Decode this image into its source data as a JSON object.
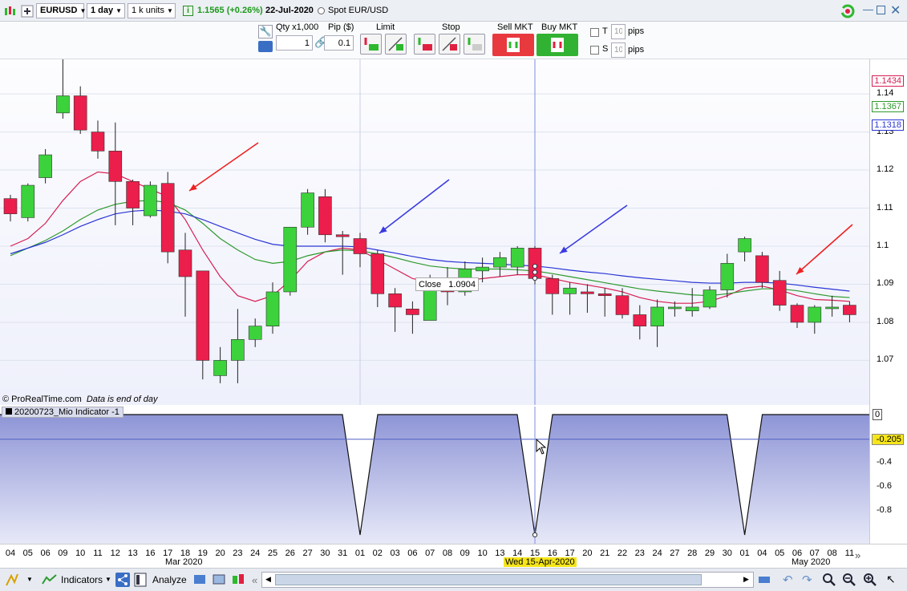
{
  "topbar": {
    "symbol": "EURUSD",
    "timeframe": "1 day",
    "units": "1 k units",
    "price": "1.1565 (+0.26%)",
    "date": "22-Jul-2020",
    "instrument": "Spot EUR/USD"
  },
  "order": {
    "qty_label": "Qty x1,000",
    "qty_value": "1",
    "pip_label": "Pip ($)",
    "pip_value": "0.1",
    "limit_label": "Limit",
    "stop_label": "Stop",
    "sell_label": "Sell MKT",
    "buy_label": "Buy MKT",
    "t_label": "T",
    "t_value": "10",
    "s_label": "S",
    "s_value": "10",
    "pips_label": "pips"
  },
  "chart": {
    "watermark": "© ProRealTime.com",
    "eod_note": "Data is end of day",
    "tooltip_label": "Close",
    "tooltip_value": "1.0904",
    "crosshair_date": "Wed 15-Apr-2020",
    "indicator_name": "20200723_Mio Indicator -1",
    "month_mar": "Mar 2020",
    "month_may": "May 2020",
    "price_ticks": [
      "1.14",
      "1.13",
      "1.12",
      "1.11",
      "1.1",
      "1.09",
      "1.08",
      "1.07"
    ],
    "price_labels": [
      "1.1434",
      "1.1367",
      "1.1318"
    ],
    "ind_ticks": [
      "0",
      "-0.4",
      "-0.6",
      "-0.8"
    ],
    "ind_current": "-0.205"
  },
  "chart_data": {
    "type": "candlestick",
    "x": [
      "04",
      "05",
      "06",
      "09",
      "10",
      "11",
      "12",
      "13",
      "16",
      "17",
      "18",
      "19",
      "20",
      "23",
      "24",
      "25",
      "26",
      "27",
      "30",
      "31",
      "01",
      "02",
      "03",
      "06",
      "07",
      "08",
      "09",
      "10",
      "13",
      "14",
      "15",
      "16",
      "17",
      "20",
      "21",
      "22",
      "23",
      "24",
      "27",
      "28",
      "29",
      "30",
      "01",
      "04",
      "05",
      "06",
      "07",
      "08",
      "11"
    ],
    "ohlc": [
      [
        1.1125,
        1.1135,
        1.1065,
        1.1085
      ],
      [
        1.1075,
        1.1165,
        1.1065,
        1.116
      ],
      [
        1.118,
        1.1255,
        1.1165,
        1.124
      ],
      [
        1.135,
        1.1495,
        1.1335,
        1.1395
      ],
      [
        1.1395,
        1.142,
        1.1295,
        1.1305
      ],
      [
        1.13,
        1.133,
        1.123,
        1.125
      ],
      [
        1.125,
        1.1325,
        1.1055,
        1.117
      ],
      [
        1.117,
        1.1175,
        1.1055,
        1.11
      ],
      [
        1.108,
        1.117,
        1.1075,
        1.116
      ],
      [
        1.1165,
        1.1195,
        1.0955,
        1.0985
      ],
      [
        1.099,
        1.1035,
        1.0815,
        1.092
      ],
      [
        1.0935,
        1.0935,
        1.065,
        1.07
      ],
      [
        1.066,
        1.0735,
        1.064,
        1.07
      ],
      [
        1.07,
        1.0835,
        1.064,
        1.0755
      ],
      [
        1.0755,
        1.081,
        1.0735,
        1.079
      ],
      [
        1.079,
        1.0905,
        1.077,
        1.088
      ],
      [
        1.088,
        1.104,
        1.087,
        1.105
      ],
      [
        1.105,
        1.115,
        1.103,
        1.114
      ],
      [
        1.113,
        1.115,
        1.101,
        1.103
      ],
      [
        1.103,
        1.104,
        1.0925,
        1.1025
      ],
      [
        1.102,
        1.1035,
        1.0945,
        1.098
      ],
      [
        1.098,
        1.099,
        1.084,
        1.0875
      ],
      [
        1.0875,
        1.089,
        1.0775,
        1.084
      ],
      [
        1.0835,
        1.0855,
        1.077,
        1.082
      ],
      [
        1.0805,
        1.0925,
        1.0805,
        1.0905
      ],
      [
        1.0905,
        1.0945,
        1.0845,
        1.088
      ],
      [
        1.088,
        1.096,
        1.087,
        1.094
      ],
      [
        1.0935,
        1.097,
        1.0905,
        1.0945
      ],
      [
        1.0945,
        1.0985,
        1.092,
        1.097
      ],
      [
        1.0945,
        1.1,
        1.0925,
        1.0995
      ],
      [
        1.0995,
        1.1,
        1.09,
        1.0915
      ],
      [
        1.0915,
        1.0925,
        1.082,
        1.0875
      ],
      [
        1.0875,
        1.0905,
        1.082,
        1.089
      ],
      [
        1.088,
        1.09,
        1.0825,
        1.0875
      ],
      [
        1.0875,
        1.089,
        1.0815,
        1.087
      ],
      [
        1.087,
        1.089,
        1.081,
        1.082
      ],
      [
        1.082,
        1.0845,
        1.0755,
        1.079
      ],
      [
        1.079,
        1.086,
        1.0735,
        1.084
      ],
      [
        1.084,
        1.0855,
        1.0815,
        1.084
      ],
      [
        1.083,
        1.089,
        1.0815,
        1.084
      ],
      [
        1.084,
        1.0895,
        1.0835,
        1.0885
      ],
      [
        1.0885,
        1.098,
        1.0865,
        1.0955
      ],
      [
        1.0985,
        1.1025,
        1.096,
        1.102
      ],
      [
        1.0975,
        1.0985,
        1.089,
        1.0905
      ],
      [
        1.091,
        1.0935,
        1.083,
        1.0845
      ],
      [
        1.0845,
        1.085,
        1.0785,
        1.08
      ],
      [
        1.08,
        1.0845,
        1.077,
        1.084
      ],
      [
        1.084,
        1.087,
        1.0815,
        1.084
      ],
      [
        1.0845,
        1.0855,
        1.08,
        1.082
      ]
    ],
    "series": [
      {
        "type": "line",
        "color": "#d61e52",
        "values": [
          1.1,
          1.102,
          1.106,
          1.112,
          1.117,
          1.1195,
          1.119,
          1.117,
          1.115,
          1.113,
          1.107,
          1.099,
          1.092,
          1.087,
          1.0855,
          1.087,
          1.091,
          1.096,
          1.0985,
          1.0995,
          1.099,
          1.0965,
          1.094,
          1.0915,
          1.0905,
          1.0905,
          1.091,
          1.0915,
          1.092,
          1.0925,
          1.0925,
          1.0915,
          1.0905,
          1.0898,
          1.089,
          1.088,
          1.0865,
          1.0855,
          1.085,
          1.085,
          1.0855,
          1.087,
          1.089,
          1.0895,
          1.0885,
          1.087,
          1.086,
          1.0858,
          1.0855
        ]
      },
      {
        "type": "line",
        "color": "#2e9a2e",
        "values": [
          1.0975,
          1.0995,
          1.1015,
          1.104,
          1.107,
          1.1095,
          1.111,
          1.1118,
          1.112,
          1.1115,
          1.1095,
          1.106,
          1.102,
          1.099,
          1.0965,
          1.0955,
          1.096,
          1.0975,
          1.0985,
          1.099,
          1.0988,
          1.098,
          1.097,
          1.0958,
          1.0948,
          1.0943,
          1.094,
          1.094,
          1.094,
          1.0938,
          1.0935,
          1.0928,
          1.092,
          1.0912,
          1.0904,
          1.0896,
          1.0888,
          1.0882,
          1.0877,
          1.0872,
          1.087,
          1.0875,
          1.0882,
          1.0888,
          1.0888,
          1.0883,
          1.0875,
          1.0868,
          1.0865
        ]
      },
      {
        "type": "line",
        "color": "#2a35d4",
        "values": [
          1.098,
          1.0995,
          1.101,
          1.103,
          1.1052,
          1.107,
          1.1085,
          1.1092,
          1.1095,
          1.1092,
          1.1085,
          1.107,
          1.1052,
          1.1035,
          1.1018,
          1.1005,
          1.1,
          1.1,
          1.1,
          1.1,
          1.0998,
          1.099,
          1.0982,
          1.0973,
          1.0965,
          1.096,
          1.0957,
          1.0955,
          1.0953,
          1.095,
          1.0948,
          1.0943,
          1.0937,
          1.0932,
          1.0928,
          1.0922,
          1.0917,
          1.0913,
          1.0909,
          1.0905,
          1.0903,
          1.0903,
          1.0905,
          1.0905,
          1.0903,
          1.0898,
          1.0892,
          1.0887,
          1.0882
        ]
      }
    ],
    "indicator": {
      "dips_at": [
        "01",
        "15"
      ],
      "base": 0,
      "min": -1
    },
    "ylim": [
      1.0595,
      1.1495
    ]
  }
}
